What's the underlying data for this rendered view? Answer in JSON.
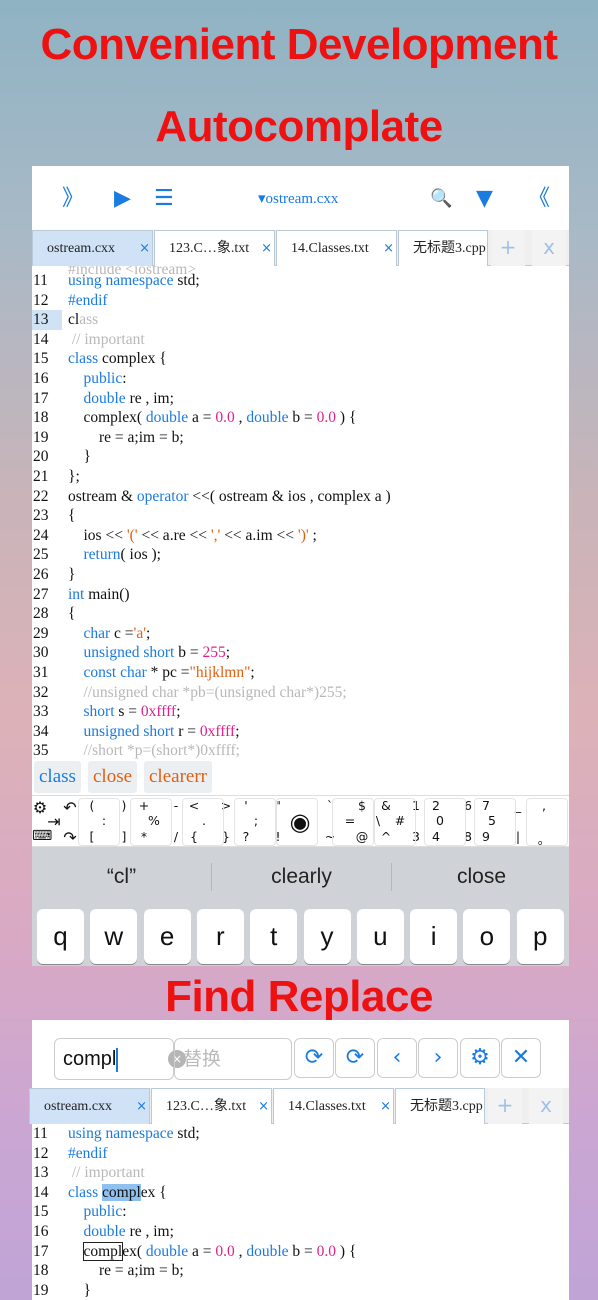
{
  "headings": {
    "h1": "Convenient Development",
    "h2": "Autocomplate",
    "h3": "Find Replace"
  },
  "toolbar": {
    "expand": "》",
    "run": "▶",
    "list": "☰",
    "file": "▾ostream.cxx",
    "search": "🔍",
    "down": "▼",
    "collapse": "《"
  },
  "tabs": [
    {
      "label": "ostream.cxx",
      "close": "×"
    },
    {
      "label": "123.C…象.txt",
      "close": "×"
    },
    {
      "label": "14.Classes.txt",
      "close": "×"
    },
    {
      "label": "无标题3.cpp",
      "close": ""
    }
  ],
  "tab_actions": {
    "add": "+",
    "close": "x"
  },
  "editor": {
    "partial_line": "#include <iostream>",
    "lines": [
      {
        "n": "11",
        "t": "using namespace std;"
      },
      {
        "n": "12",
        "t": "#endif"
      },
      {
        "n": "13",
        "t": "class"
      },
      {
        "n": "14",
        "t": " // important"
      },
      {
        "n": "15",
        "t": "class complex {"
      },
      {
        "n": "16",
        "t": "    public:"
      },
      {
        "n": "17",
        "t": "    double re , im;"
      },
      {
        "n": "18",
        "t": "    complex( double a = 0.0 , double b = 0.0 ) {"
      },
      {
        "n": "19",
        "t": "        re = a;im = b;"
      },
      {
        "n": "20",
        "t": "    }"
      },
      {
        "n": "21",
        "t": "};"
      },
      {
        "n": "22",
        "t": "ostream & operator <<( ostream & ios , complex a )"
      },
      {
        "n": "23",
        "t": "{"
      },
      {
        "n": "24",
        "t": "    ios << '(' << a.re << ',' << a.im << ')' ;"
      },
      {
        "n": "25",
        "t": "    return( ios );"
      },
      {
        "n": "26",
        "t": "}"
      },
      {
        "n": "27",
        "t": "int main()"
      },
      {
        "n": "28",
        "t": "{"
      },
      {
        "n": "29",
        "t": "    char c ='a';"
      },
      {
        "n": "30",
        "t": "    unsigned short b = 255;"
      },
      {
        "n": "31",
        "t": "    const char * pc =\"hijklmn\";"
      },
      {
        "n": "32",
        "t": "    //unsigned char *pb=(unsigned char*)255;"
      },
      {
        "n": "33",
        "t": "    short s = 0xffff;"
      },
      {
        "n": "34",
        "t": "    unsigned short r = 0xffff;"
      },
      {
        "n": "35",
        "t": "    //short *p=(short*)0xffff;"
      }
    ]
  },
  "autocomplete": [
    "class",
    "close",
    "clearerr"
  ],
  "symbols": {
    "top": [
      "(",
      ")",
      "+",
      "-",
      "<",
      ">",
      "'",
      "\"",
      "`",
      "$",
      "&",
      "1",
      "2",
      "6",
      "7",
      "_",
      ","
    ],
    "mid": [
      ":",
      "%",
      ".",
      ";",
      "=",
      "#",
      "0",
      "5",
      "\\"
    ],
    "bottom": [
      "[",
      "]",
      "*",
      "/",
      "{",
      "}",
      "?",
      "!",
      "~",
      "@",
      "^",
      "3",
      "4",
      "8",
      "9",
      "|",
      "。"
    ]
  },
  "predictions": [
    "“cl”",
    "clearly",
    "close"
  ],
  "keyboard": [
    "q",
    "w",
    "e",
    "r",
    "t",
    "y",
    "u",
    "i",
    "o",
    "p"
  ],
  "find": {
    "query": "compl",
    "replace_placeholder": "替换",
    "clear": "×"
  },
  "find_buttons": {
    "replace": "⟳",
    "replace_all": "⟳",
    "prev": "‹",
    "next": "›",
    "settings": "⚙",
    "close": "✕"
  },
  "editor2": {
    "lines": [
      {
        "n": "11",
        "t": "using namespace std;"
      },
      {
        "n": "12",
        "t": "#endif"
      },
      {
        "n": "13",
        "t": " // important"
      },
      {
        "n": "14",
        "t": "class complex {"
      },
      {
        "n": "15",
        "t": "    public:"
      },
      {
        "n": "16",
        "t": "    double re , im;"
      },
      {
        "n": "17",
        "t": "    complex( double a = 0.0 , double b = 0.0 ) {"
      },
      {
        "n": "18",
        "t": "        re = a;im = b;"
      },
      {
        "n": "19",
        "t": "    }"
      }
    ]
  },
  "colors": {
    "headline": "#ee1111",
    "accent": "#1a7be0",
    "keyword": "#1a7be0",
    "string": "#e06010",
    "number": "#e0208a",
    "comment": "#b8b8b8"
  }
}
